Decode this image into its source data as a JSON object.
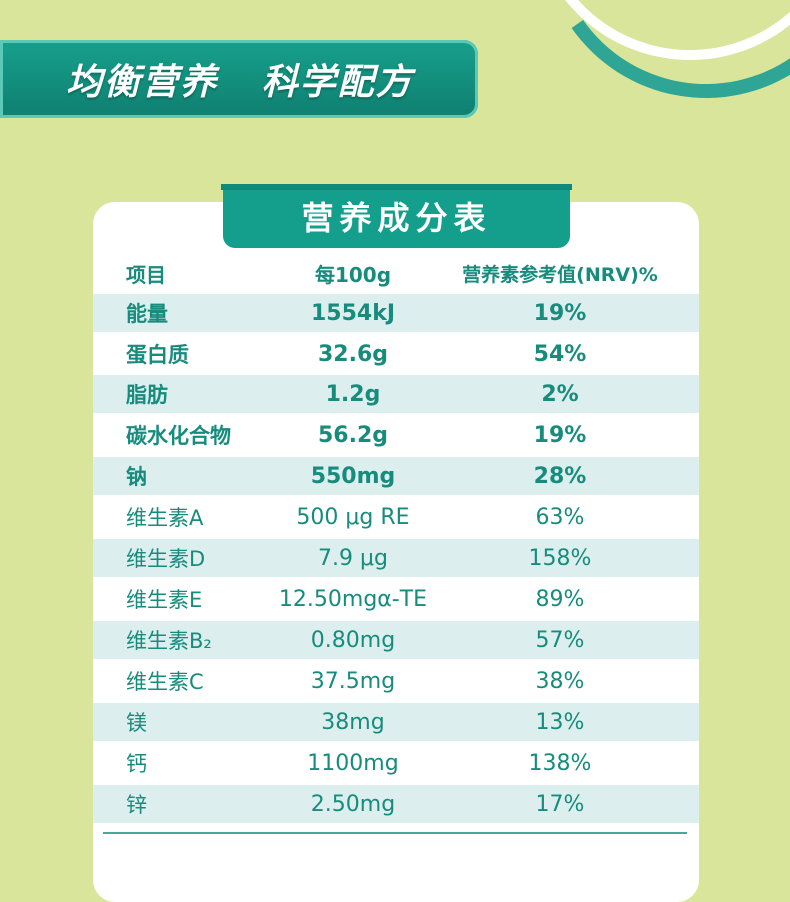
{
  "banner": {
    "title": "均衡营养   科学配方"
  },
  "table": {
    "title": "营养成分表",
    "headers": [
      "项目",
      "每100g",
      "营养素参考值(NRV)%"
    ],
    "rows": [
      {
        "item": "能量",
        "per100g": "1554kJ",
        "nrv": "19%",
        "bold": true
      },
      {
        "item": "蛋白质",
        "per100g": "32.6g",
        "nrv": "54%",
        "bold": true
      },
      {
        "item": "脂肪",
        "per100g": "1.2g",
        "nrv": "2%",
        "bold": true
      },
      {
        "item": "碳水化合物",
        "per100g": "56.2g",
        "nrv": "19%",
        "bold": true
      },
      {
        "item": "钠",
        "per100g": "550mg",
        "nrv": "28%",
        "bold": true
      },
      {
        "item": "维生素A",
        "per100g": "500 μg RE",
        "nrv": "63%",
        "bold": false
      },
      {
        "item": "维生素D",
        "per100g": "7.9 μg",
        "nrv": "158%",
        "bold": false
      },
      {
        "item": "维生素E",
        "per100g": "12.50mgα-TE",
        "nrv": "89%",
        "bold": false
      },
      {
        "item": "维生素B₂",
        "per100g": "0.80mg",
        "nrv": "57%",
        "bold": false
      },
      {
        "item": "维生素C",
        "per100g": "37.5mg",
        "nrv": "38%",
        "bold": false
      },
      {
        "item": "镁",
        "per100g": "38mg",
        "nrv": "13%",
        "bold": false
      },
      {
        "item": "钙",
        "per100g": "1100mg",
        "nrv": "138%",
        "bold": false
      },
      {
        "item": "锌",
        "per100g": "2.50mg",
        "nrv": "17%",
        "bold": false
      }
    ]
  },
  "colors": {
    "background": "#d9e59a",
    "accent": "#149f8c",
    "text": "#178c7d",
    "row_shade": "#dcefee"
  }
}
